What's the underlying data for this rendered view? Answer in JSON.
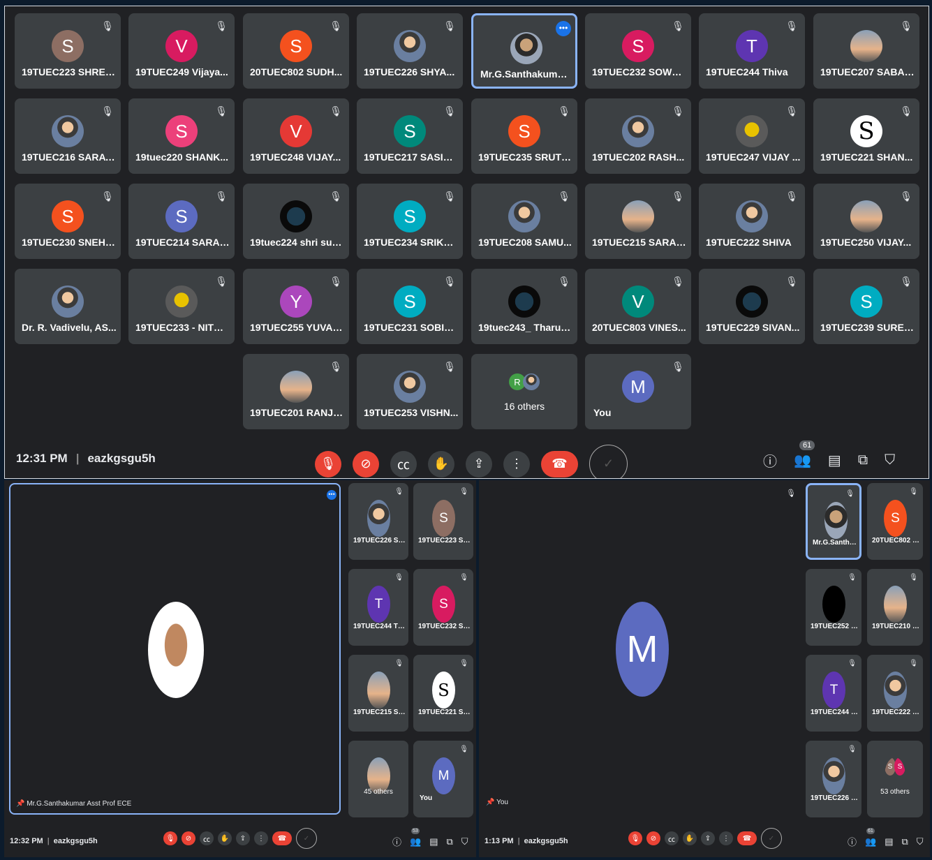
{
  "colors": {
    "meet_bg": "#202124",
    "tile": "#3c4043",
    "accent": "#8ab4f8",
    "red": "#ea4335",
    "blue_badge": "#1a73e8"
  },
  "top": {
    "participants": [
      {
        "name": "19TUEC223 SHREE ...",
        "letter": "S",
        "color": "#8d6e63",
        "avatar": "letter"
      },
      {
        "name": "19TUEC249 Vijaya...",
        "letter": "V",
        "color": "#d81b60",
        "avatar": "letter"
      },
      {
        "name": "20TUEC802 SUDH...",
        "letter": "S",
        "color": "#f4511e",
        "avatar": "letter"
      },
      {
        "name": "19TUEC226 SHYA...",
        "letter": "",
        "color": "",
        "avatar": "photo"
      },
      {
        "name": "Mr.G.Santhakumar...",
        "letter": "",
        "color": "",
        "avatar": "photo2",
        "active": true
      },
      {
        "name": "19TUEC232 SOWM...",
        "letter": "S",
        "color": "#d81b60",
        "avatar": "letter"
      },
      {
        "name": "19TUEC244 Thiva",
        "letter": "T",
        "color": "#5e35b1",
        "avatar": "letter"
      },
      {
        "name": "19TUEC207 SABAR...",
        "letter": "",
        "color": "",
        "avatar": "photo3"
      },
      {
        "name": "19TUEC216 SARAT...",
        "letter": "",
        "color": "",
        "avatar": "photo"
      },
      {
        "name": "19tuec220 SHANK...",
        "letter": "S",
        "color": "#ec407a",
        "avatar": "letter"
      },
      {
        "name": "19TUEC248 VIJAY...",
        "letter": "V",
        "color": "#e53935",
        "avatar": "letter"
      },
      {
        "name": "19TUEC217 SASIKU...",
        "letter": "S",
        "color": "#00897b",
        "avatar": "letter"
      },
      {
        "name": "19TUEC235 SRUTH...",
        "letter": "S",
        "color": "#f4511e",
        "avatar": "letter"
      },
      {
        "name": "19TUEC202 RASH...",
        "letter": "",
        "color": "",
        "avatar": "photo"
      },
      {
        "name": "19TUEC247 VIJAY ...",
        "letter": "",
        "color": "",
        "avatar": "photo5"
      },
      {
        "name": "19TUEC221 SHAN...",
        "letter": "S",
        "color": "#ffffff",
        "avatar": "logo"
      },
      {
        "name": "19TUEC230 SNEHA...",
        "letter": "S",
        "color": "#f4511e",
        "avatar": "letter"
      },
      {
        "name": "19TUEC214 SARAN...",
        "letter": "S",
        "color": "#5c6bc0",
        "avatar": "letter"
      },
      {
        "name": "19tuec224 shri sud...",
        "letter": "",
        "color": "",
        "avatar": "photo4"
      },
      {
        "name": "19TUEC234 SRIKA...",
        "letter": "S",
        "color": "#00acc1",
        "avatar": "letter"
      },
      {
        "name": "19TUEC208 SAMU...",
        "letter": "",
        "color": "",
        "avatar": "photo"
      },
      {
        "name": "19TUEC215 SARAN...",
        "letter": "",
        "color": "",
        "avatar": "photo3"
      },
      {
        "name": "19TUEC222 SHIVA",
        "letter": "",
        "color": "",
        "avatar": "photo"
      },
      {
        "name": "19TUEC250 VIJAY...",
        "letter": "",
        "color": "",
        "avatar": "photo3"
      },
      {
        "name": "Dr. R. Vadivelu, AS...",
        "letter": "",
        "color": "",
        "avatar": "photo",
        "nomic": true
      },
      {
        "name": "19TUEC233 - NITHIN",
        "letter": "",
        "color": "",
        "avatar": "photo5"
      },
      {
        "name": "19TUEC255 YUVAR...",
        "letter": "Y",
        "color": "#ab47bc",
        "avatar": "letter"
      },
      {
        "name": "19TUEC231 SOBIH...",
        "letter": "S",
        "color": "#00acc1",
        "avatar": "letter"
      },
      {
        "name": "19tuec243_ Tharun...",
        "letter": "",
        "color": "",
        "avatar": "photo4"
      },
      {
        "name": "20TUEC803 VINES...",
        "letter": "V",
        "color": "#00897b",
        "avatar": "letter"
      },
      {
        "name": "19TUEC229 SIVAN...",
        "letter": "",
        "color": "",
        "avatar": "photo4"
      },
      {
        "name": "19TUEC239 SUREN...",
        "letter": "S",
        "color": "#00acc1",
        "avatar": "letter"
      },
      {
        "name": "19TUEC201 RANJE...",
        "letter": "",
        "color": "",
        "avatar": "photo3"
      },
      {
        "name": "19TUEC253 VISHN...",
        "letter": "",
        "color": "",
        "avatar": "photo"
      },
      {
        "name": "16 others",
        "letter": "R",
        "color": "#43a047",
        "avatar": "others",
        "nomic": true
      },
      {
        "name": "You",
        "letter": "M",
        "color": "#5c6bc0",
        "avatar": "letter",
        "you": true
      }
    ],
    "time": "12:31 PM",
    "code": "eazkgsgu5h",
    "people_count": "61"
  },
  "bottom_left": {
    "main_name": "Mr.G.Santhakumar Asst Prof ECE",
    "tiles": [
      {
        "name": "19TUEC226 SHYAM S...",
        "letter": "",
        "color": "",
        "avatar": "photo"
      },
      {
        "name": "19TUEC223 SHREE SH...",
        "letter": "S",
        "color": "#8d6e63",
        "avatar": "letter"
      },
      {
        "name": "19TUEC244 Thiva",
        "letter": "T",
        "color": "#5e35b1",
        "avatar": "letter"
      },
      {
        "name": "19TUEC232 SOWMIY...",
        "letter": "S",
        "color": "#d81b60",
        "avatar": "letter"
      },
      {
        "name": "19TUEC215 SARANYA.P",
        "letter": "",
        "color": "",
        "avatar": "photo3"
      },
      {
        "name": "19TUEC221 SHANMU...",
        "letter": "S",
        "color": "#ffffff",
        "avatar": "logo"
      },
      {
        "name": "45 others",
        "letter": "",
        "color": "",
        "avatar": "photo3",
        "nomic": true
      },
      {
        "name": "You",
        "letter": "M",
        "color": "#5c6bc0",
        "avatar": "letter",
        "you": true
      }
    ],
    "time": "12:32 PM",
    "code": "eazkgsgu5h",
    "people_count": "53"
  },
  "bottom_right": {
    "main_letter": "M",
    "main_name": "You",
    "tiles": [
      {
        "name": "Mr.G.Santhakumar A...",
        "letter": "",
        "color": "",
        "avatar": "photo2",
        "active": true
      },
      {
        "name": "20TUEC802 SUDHAR...",
        "letter": "S",
        "color": "#f4511e",
        "avatar": "letter"
      },
      {
        "name": "19TUEC252 VISHNU.V",
        "letter": "",
        "color": "#000000",
        "avatar": "black"
      },
      {
        "name": "19TUEC210 SANJAY.M",
        "letter": "",
        "color": "",
        "avatar": "photo3"
      },
      {
        "name": "19TUEC244 Thiva",
        "letter": "T",
        "color": "#5e35b1",
        "avatar": "letter"
      },
      {
        "name": "19TUEC222 SHIVA",
        "letter": "",
        "color": "",
        "avatar": "photo"
      },
      {
        "name": "19TUEC226 SHYAM S...",
        "letter": "",
        "color": "",
        "avatar": "photo"
      },
      {
        "name": "53 others",
        "letter": "S",
        "color": "#8d6e63",
        "avatar": "others2",
        "nomic": true
      }
    ],
    "time": "1:13 PM",
    "code": "eazkgsgu5h",
    "people_count": "61"
  }
}
